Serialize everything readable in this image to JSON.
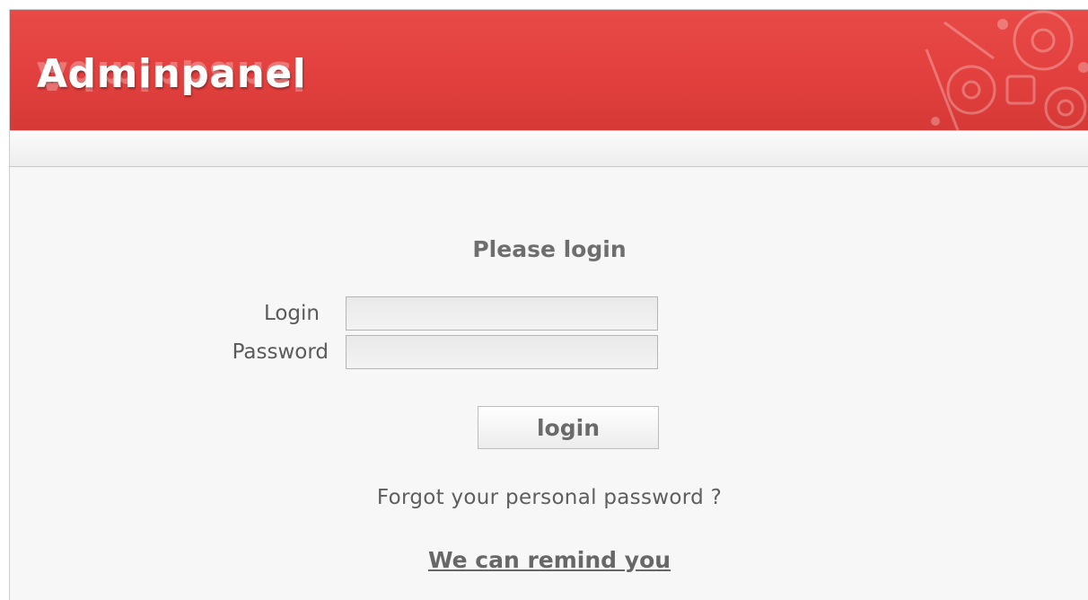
{
  "header": {
    "brand": "Adminpanel",
    "accent_color": "#e2403e",
    "decoration_icon": "gears-icon"
  },
  "login_form": {
    "title": "Please login",
    "login_label": "Login",
    "login_value": "",
    "password_label": "Password",
    "password_value": "",
    "submit_label": "login",
    "forgot_text": "Forgot your personal password ?",
    "remind_link": "We can remind you"
  }
}
